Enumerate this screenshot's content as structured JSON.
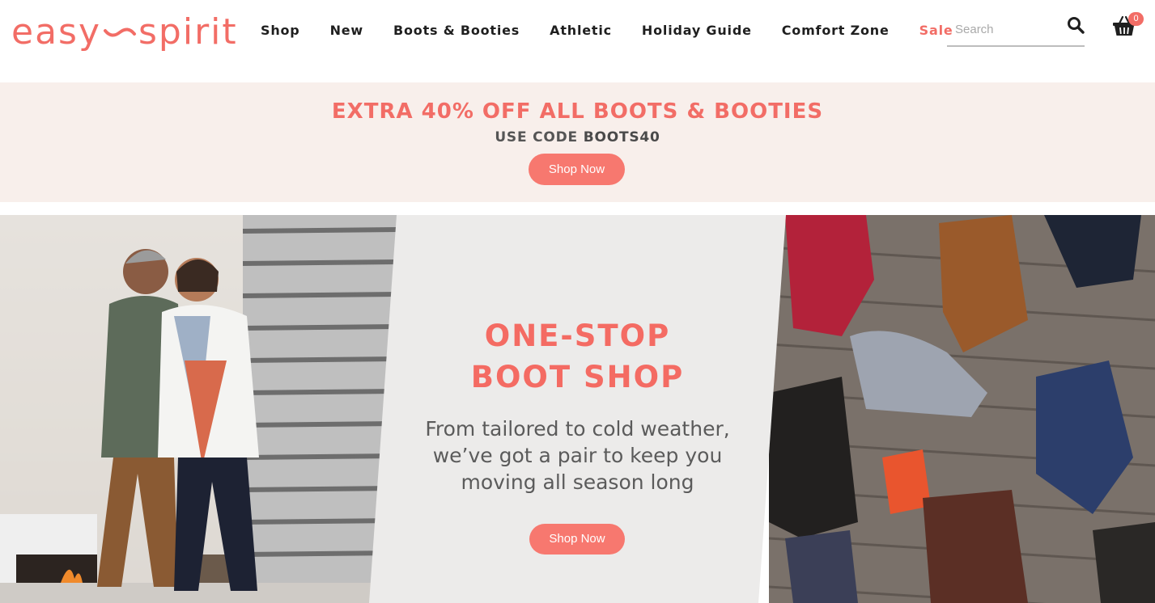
{
  "brand": {
    "logo_left": "easy",
    "logo_right": "spirit",
    "accent_color": "#f26d66"
  },
  "nav": {
    "items": [
      "Shop",
      "New",
      "Boots & Booties",
      "Athletic",
      "Holiday Guide",
      "Comfort Zone",
      "Sale"
    ],
    "sale_color": "#f26d66"
  },
  "search": {
    "placeholder": "Search",
    "icon": "search-icon"
  },
  "cart": {
    "icon": "basket-icon",
    "count": "0"
  },
  "promo": {
    "headline": "EXTRA 40% OFF ALL BOOTS & BOOTIES",
    "code_prefix": "USE CODE",
    "code": "BOOTS40",
    "button_label": "Shop Now",
    "background": "#f8efeb"
  },
  "hero": {
    "title_line1": "ONE-STOP",
    "title_line2": "BOOT SHOP",
    "subtitle_line1": "From tailored to cold weather,",
    "subtitle_line2": "we’ve got a pair to keep you",
    "subtitle_line3": "moving all season long",
    "button_label": "Shop Now"
  }
}
